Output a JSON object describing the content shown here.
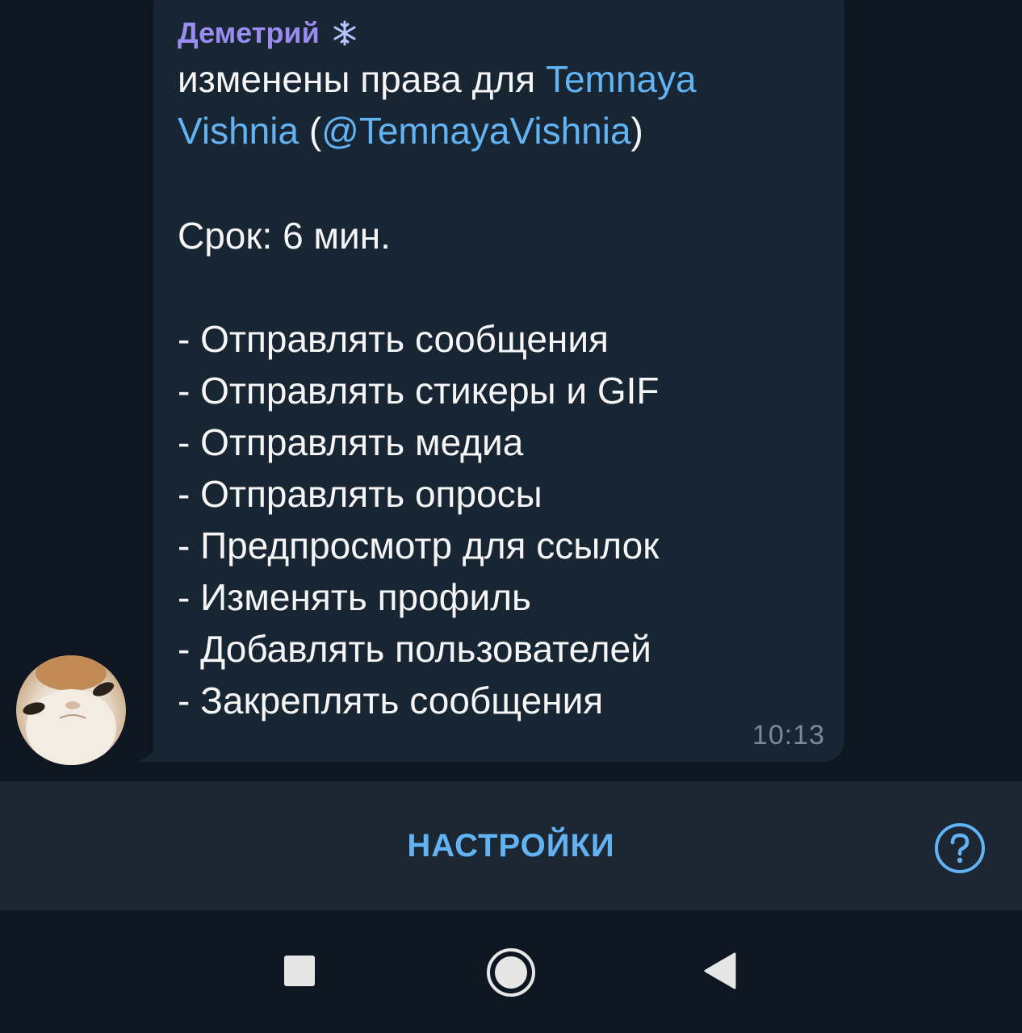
{
  "message": {
    "sender": "Деметрий",
    "line1_text": "изменены права для ",
    "line1_link": "Temnaya",
    "line2_link": "Vishnia",
    "line2_mid": " (",
    "line2_handle": "@TemnayaVishnia",
    "line2_end": ")",
    "term": "Срок: 6 мин.",
    "permissions": [
      "- Отправлять сообщения",
      "- Отправлять стикеры и GIF",
      "- Отправлять медиа",
      "- Отправлять опросы",
      "- Предпросмотр для ссылок",
      "- Изменять профиль",
      "- Добавлять пользователей",
      "- Закреплять сообщения"
    ],
    "time": "10:13"
  },
  "settings_bar": {
    "settings_label": "НАСТРОЙКИ",
    "help_icon": "question-circle-icon"
  },
  "nav_bar": {
    "recents_icon": "square-icon",
    "home_icon": "circle-icon",
    "back_icon": "triangle-back-icon"
  },
  "colors": {
    "background": "#0e1621",
    "bubble": "#182533",
    "sender": "#9a8cf0",
    "link": "#62b3f3",
    "accent": "#62b3f3",
    "text": "#f5f5f5",
    "time": "#7b8a99"
  }
}
